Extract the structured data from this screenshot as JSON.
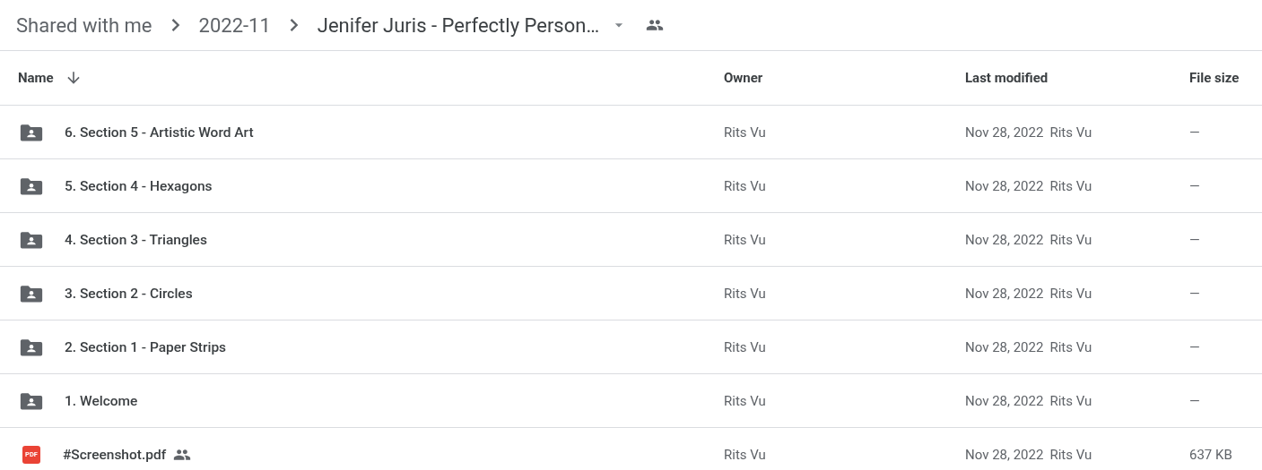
{
  "breadcrumb": [
    {
      "label": "Shared with me"
    },
    {
      "label": "2022-11"
    },
    {
      "label": "Jenifer Juris - Perfectly Person…",
      "current": true,
      "shared": true
    }
  ],
  "table": {
    "columns": [
      {
        "label": "Name",
        "sorted": true
      },
      {
        "label": "Owner",
        "sorted": false
      },
      {
        "label": "Last modified",
        "sorted": false
      },
      {
        "label": "File size",
        "sorted": false
      }
    ],
    "rows": [
      {
        "kind": "folder",
        "name": "6. Section 5 - Artistic Word Art",
        "shared": false,
        "owner": "Rits Vu",
        "modified": "Nov 28, 2022",
        "modified_by": "Rits Vu",
        "size": "—"
      },
      {
        "kind": "folder",
        "name": "5. Section 4 - Hexagons",
        "shared": false,
        "owner": "Rits Vu",
        "modified": "Nov 28, 2022",
        "modified_by": "Rits Vu",
        "size": "—"
      },
      {
        "kind": "folder",
        "name": "4. Section 3 - Triangles",
        "shared": false,
        "owner": "Rits Vu",
        "modified": "Nov 28, 2022",
        "modified_by": "Rits Vu",
        "size": "—"
      },
      {
        "kind": "folder",
        "name": "3. Section 2 - Circles",
        "shared": false,
        "owner": "Rits Vu",
        "modified": "Nov 28, 2022",
        "modified_by": "Rits Vu",
        "size": "—"
      },
      {
        "kind": "folder",
        "name": "2. Section 1 - Paper Strips",
        "shared": false,
        "owner": "Rits Vu",
        "modified": "Nov 28, 2022",
        "modified_by": "Rits Vu",
        "size": "—"
      },
      {
        "kind": "folder",
        "name": "1. Welcome",
        "shared": false,
        "owner": "Rits Vu",
        "modified": "Nov 28, 2022",
        "modified_by": "Rits Vu",
        "size": "—"
      },
      {
        "kind": "pdf",
        "icon_label": "PDF",
        "name": "#Screenshot.pdf",
        "shared": true,
        "owner": "Rits Vu",
        "modified": "Nov 28, 2022",
        "modified_by": "Rits Vu",
        "size": "637 KB"
      }
    ]
  }
}
